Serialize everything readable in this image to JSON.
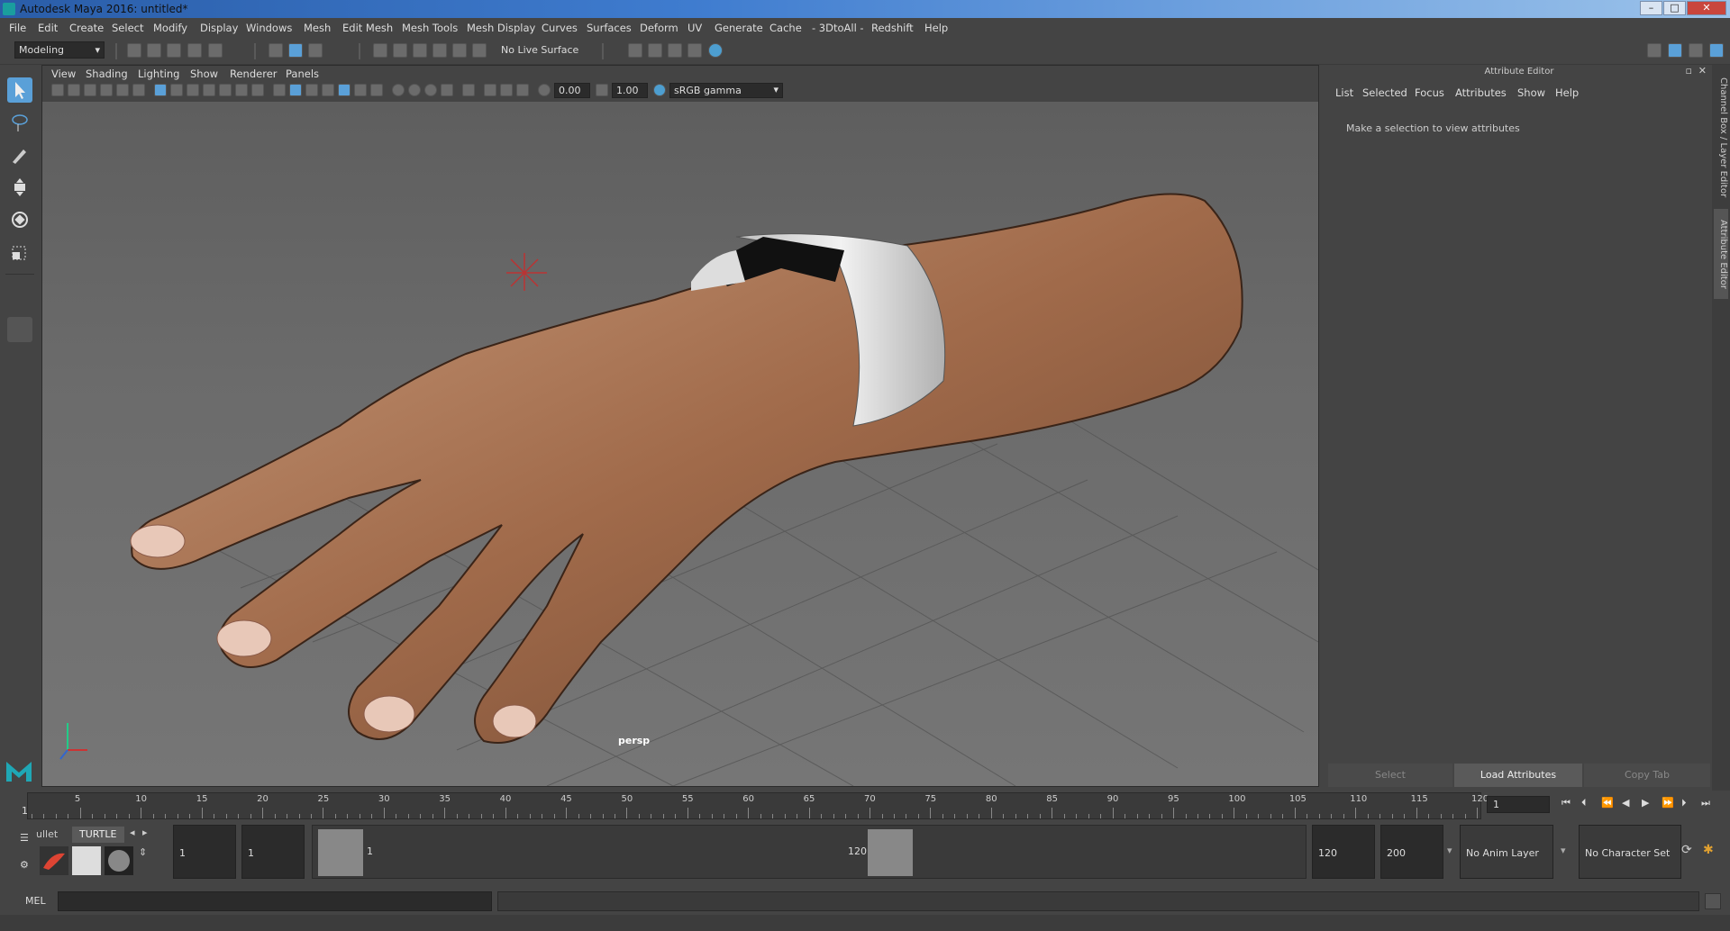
{
  "window": {
    "title": "Autodesk Maya 2016: untitled*",
    "min": "–",
    "max": "□",
    "close": "✕"
  },
  "menus": [
    "File",
    "Edit",
    "Create",
    "Select",
    "Modify",
    "Display",
    "Windows",
    "Mesh",
    "Edit Mesh",
    "Mesh Tools",
    "Mesh Display",
    "Curves",
    "Surfaces",
    "Deform",
    "UV",
    "Generate",
    "Cache",
    "- 3DtoAll -",
    "Redshift",
    "Help"
  ],
  "shelf": {
    "mode": "Modeling",
    "live_surface": "No Live Surface"
  },
  "viewport": {
    "menus": [
      "View",
      "Shading",
      "Lighting",
      "Show",
      "Renderer",
      "Panels"
    ],
    "exposure": "0.00",
    "gamma": "1.00",
    "color_space": "sRGB gamma",
    "camera_label": "persp"
  },
  "attribute_editor": {
    "header": "Attribute Editor",
    "menus": [
      "List",
      "Selected",
      "Focus",
      "Attributes",
      "Show",
      "Help"
    ],
    "message": "Make a selection to view attributes",
    "buttons": {
      "select": "Select",
      "load": "Load Attributes",
      "copy": "Copy Tab"
    }
  },
  "side_tabs": {
    "channel_box": "Channel Box / Layer Editor",
    "attribute_editor": "Attribute Editor"
  },
  "timeline": {
    "start_label": "1",
    "ticks": [
      "5",
      "10",
      "15",
      "20",
      "25",
      "30",
      "35",
      "40",
      "45",
      "50",
      "55",
      "60",
      "65",
      "70",
      "75",
      "80",
      "85",
      "90",
      "95",
      "100",
      "105",
      "110",
      "115",
      "120"
    ],
    "current_frame": "1"
  },
  "range": {
    "shelf_tabs": [
      "ullet",
      "TURTLE"
    ],
    "start_time": "1",
    "playback_start": "1",
    "slider_start": "1",
    "slider_end": "120",
    "playback_end": "120",
    "end_time": "200",
    "anim_layer": "No Anim Layer",
    "character_set": "No Character Set"
  },
  "command": {
    "label": "MEL"
  },
  "colors": {
    "accent": "#5aa0d8",
    "skin": "#b07a5a",
    "band": "#e8e8e8"
  }
}
